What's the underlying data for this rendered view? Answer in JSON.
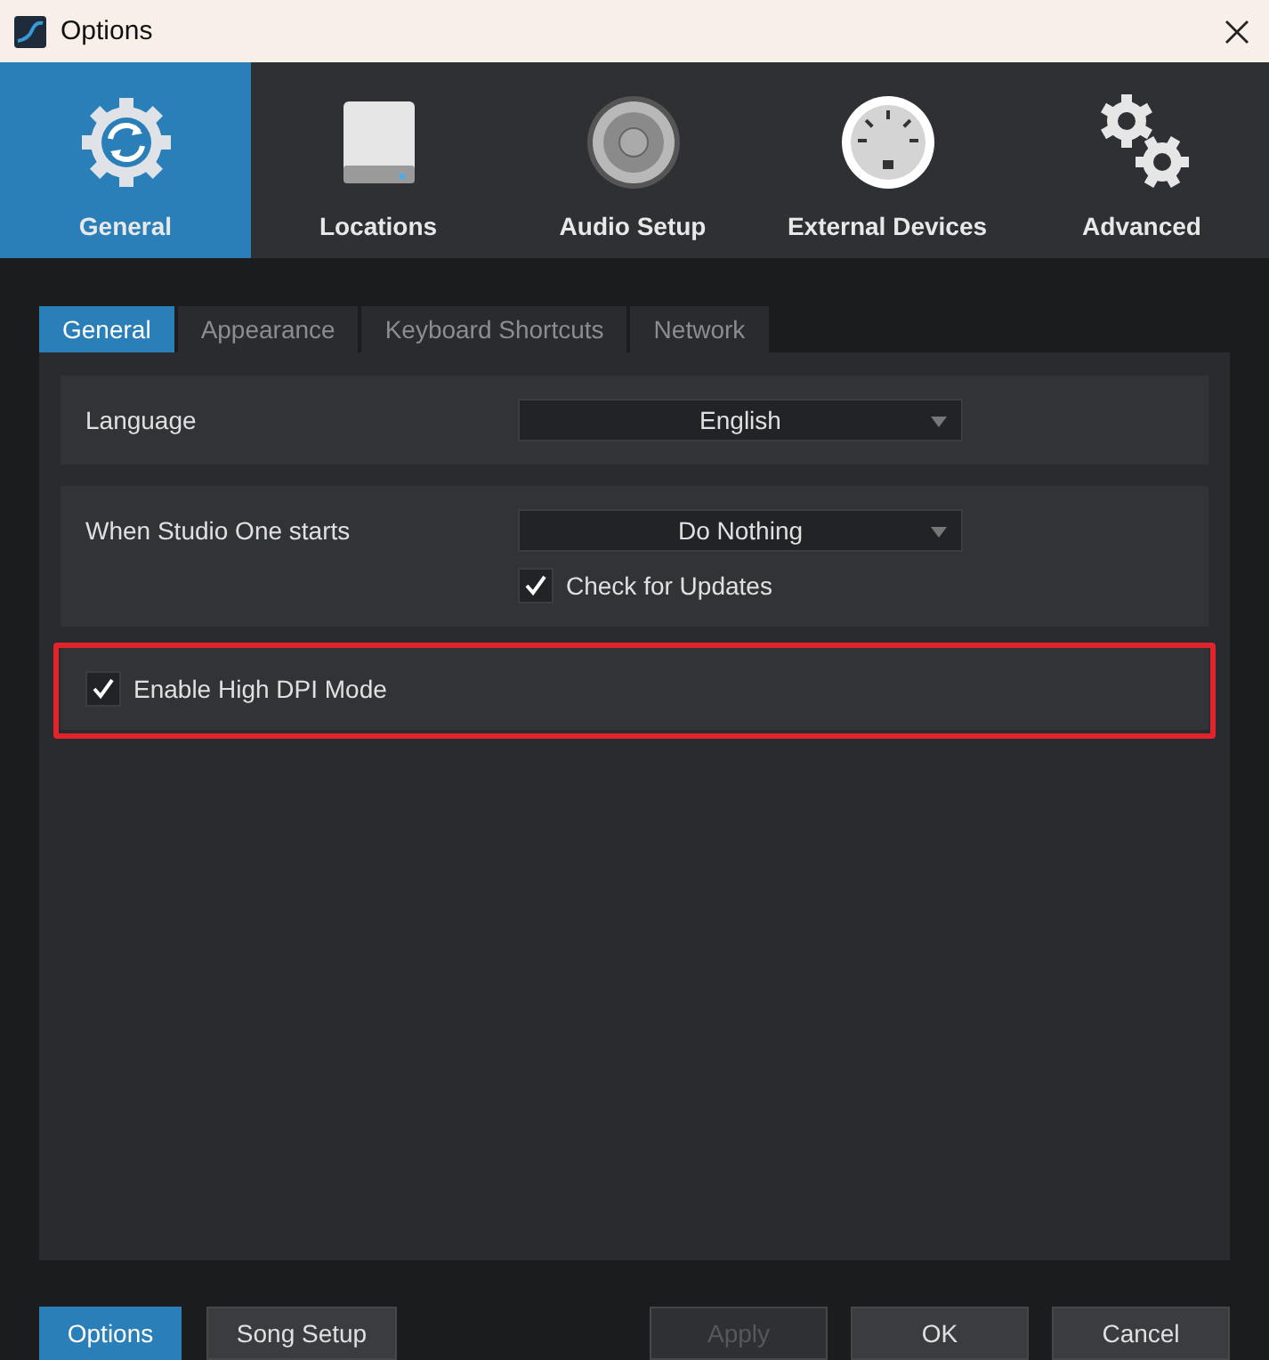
{
  "window": {
    "title": "Options"
  },
  "categories": [
    {
      "label": "General",
      "selected": true
    },
    {
      "label": "Locations",
      "selected": false
    },
    {
      "label": "Audio Setup",
      "selected": false
    },
    {
      "label": "External Devices",
      "selected": false
    },
    {
      "label": "Advanced",
      "selected": false
    }
  ],
  "tabs": [
    {
      "label": "General",
      "selected": true
    },
    {
      "label": "Appearance",
      "selected": false
    },
    {
      "label": "Keyboard Shortcuts",
      "selected": false
    },
    {
      "label": "Network",
      "selected": false
    }
  ],
  "settings": [
    {
      "kind": "select",
      "label": "Language",
      "value": "English",
      "highlighted": false
    },
    {
      "kind": "select",
      "label": "When Studio One starts",
      "value": "Do Nothing",
      "highlighted": false,
      "checkbox": {
        "label": "Check for Updates",
        "checked": true
      }
    },
    {
      "kind": "checkbox",
      "label": "Enable High DPI Mode",
      "checked": true,
      "highlighted": true
    }
  ],
  "footer": {
    "left": [
      {
        "label": "Options",
        "selected": true
      },
      {
        "label": "Song Setup",
        "selected": false
      }
    ],
    "right": [
      {
        "label": "Apply",
        "disabled": true
      },
      {
        "label": "OK",
        "disabled": false
      },
      {
        "label": "Cancel",
        "disabled": false
      }
    ]
  }
}
